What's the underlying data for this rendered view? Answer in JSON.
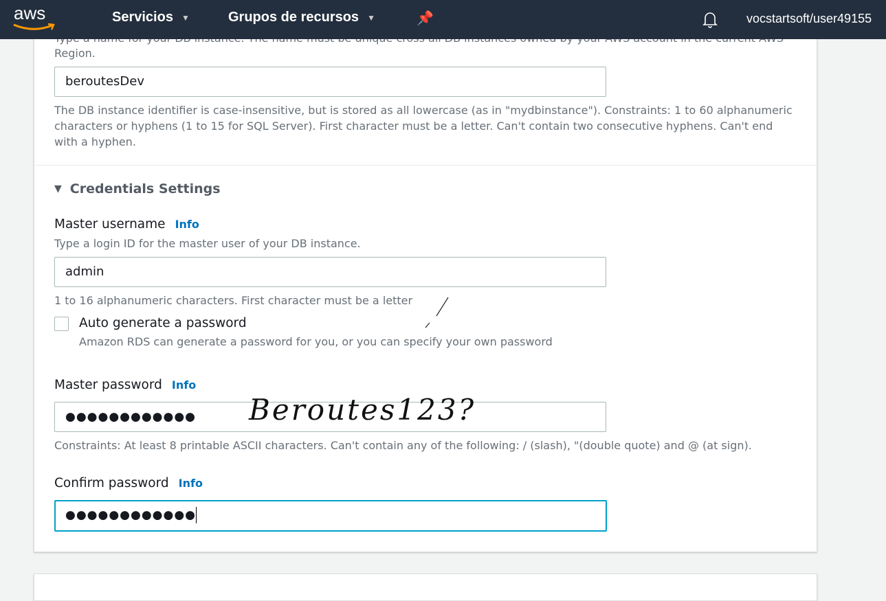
{
  "nav": {
    "logo": "aws",
    "services": "Servicios",
    "resource_groups": "Grupos de recursos",
    "user": "vocstartsoft/user49155",
    "colors": {
      "bar": "#232f3e",
      "logo_smile": "#ff9900"
    }
  },
  "form": {
    "identifier_help_top": "Type a name for your DB instance. The name must be unique cross all DB instances owned by your AWS account in the current AWS",
    "identifier_help_top2": "Region.",
    "identifier_value": "beroutesDev",
    "identifier_constraints_1": "The DB instance identifier is case-insensitive, but is stored as all lowercase (as in \"mydbinstance\"). Constraints: 1 to 60 alphanumeric",
    "identifier_constraints_2": "characters or hyphens (1 to 15 for SQL Server). First character must be a letter. Can't contain two consecutive hyphens. Can't end",
    "identifier_constraints_3": "with a hyphen.",
    "credentials_title": "Credentials Settings",
    "master_username_label": "Master username",
    "info": "Info",
    "master_username_help": "Type a login ID for the master user of your DB instance.",
    "master_username_value": "admin",
    "master_username_constraints": "1 to 16 alphanumeric characters. First character must be a letter",
    "auto_generate_label": "Auto generate a password",
    "auto_generate_checked": false,
    "auto_generate_help": "Amazon RDS can generate a password for you, or you can specify your own password",
    "master_password_label": "Master password",
    "master_password_value": "●●●●●●●●●●●●",
    "master_password_constraints": "Constraints: At least 8 printable ASCII characters. Can't contain any of the following: / (slash), \"(double quote) and @ (at sign).",
    "confirm_password_label": "Confirm password",
    "confirm_password_value": "●●●●●●●●●●●●"
  },
  "annotation": {
    "handwritten": "Beroutes123?"
  }
}
